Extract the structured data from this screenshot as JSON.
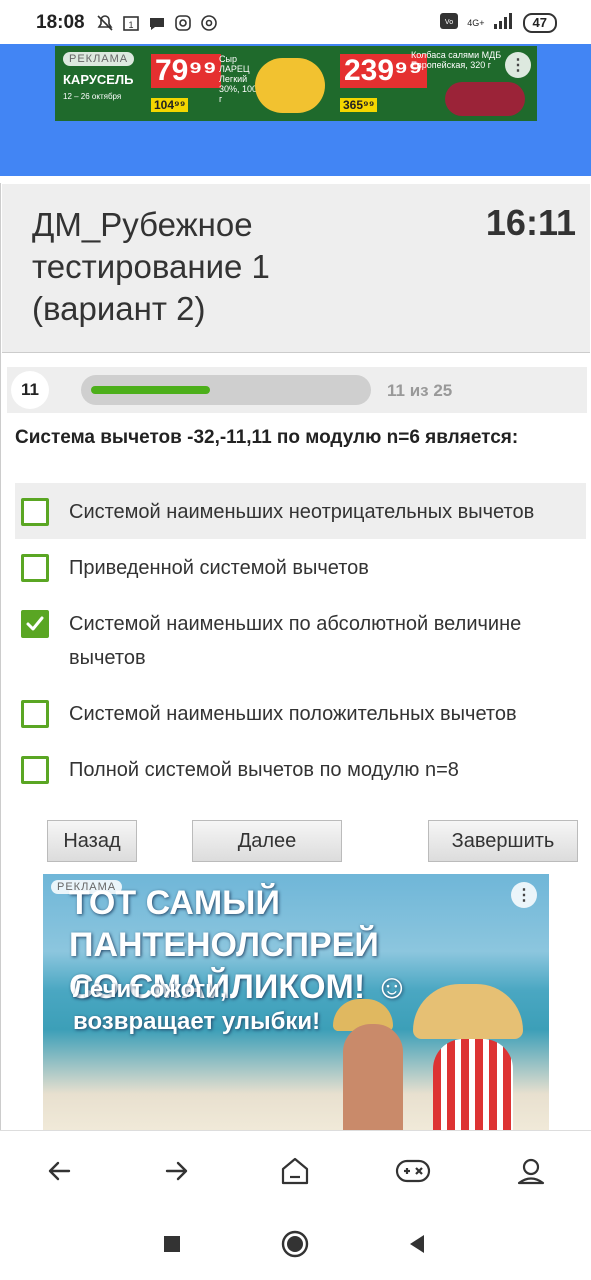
{
  "status_bar": {
    "time": "18:08",
    "network": "4G+",
    "battery": "47"
  },
  "top_ad": {
    "badge": "РЕКЛАМА",
    "brand": "КАРУСЕЛЬ",
    "dates": "12 – 26 октября",
    "price1": "79⁹⁹",
    "price1_old": "104⁹⁹",
    "product1": "Сыр ЛАРЕЦ Легкий 30%, 100 г",
    "price2": "239⁹⁹",
    "price2_old": "365⁹⁹",
    "product2": "Колбаса салями МДБ Европейская, 320 г"
  },
  "quiz": {
    "title": "ДМ_Рубежное тестирование 1 (вариант 2)",
    "timer": "16:11",
    "question_number": "11",
    "progress_text": "11 из 25",
    "progress_fraction": 0.44,
    "question": "Система вычетов -32,-11,11 по модулю n=6 является:",
    "options": [
      {
        "label": "Системой наименьших неотрицательных вычетов",
        "checked": false,
        "highlighted": true
      },
      {
        "label": "Приведенной системой вычетов",
        "checked": false,
        "highlighted": false
      },
      {
        "label": "Системой наименьших по абсолютной величине вычетов",
        "checked": true,
        "highlighted": false
      },
      {
        "label": "Системой наименьших положительных вычетов",
        "checked": false,
        "highlighted": false
      },
      {
        "label": "Полной системой вычетов по модулю n=8",
        "checked": false,
        "highlighted": false
      }
    ],
    "buttons": {
      "back": "Назад",
      "next": "Далее",
      "finish": "Завершить"
    }
  },
  "bottom_ad": {
    "badge": "РЕКЛАМА",
    "headline_line1": "ТОТ САМЫЙ ПАНТЕНОЛСПРЕЙ",
    "headline_line2": "СО СМАЙЛИКОМ! ☺",
    "sub_line1": "Лечит ожоги,",
    "sub_line2": "возвращает улыбки!"
  },
  "colors": {
    "accent_green": "#5aa623",
    "header_bg": "#eeeeee",
    "browser_blue": "#4285f4"
  },
  "nav_icons": [
    "back-arrow-icon",
    "forward-arrow-icon",
    "home-icon",
    "games-icon",
    "profile-icon"
  ]
}
